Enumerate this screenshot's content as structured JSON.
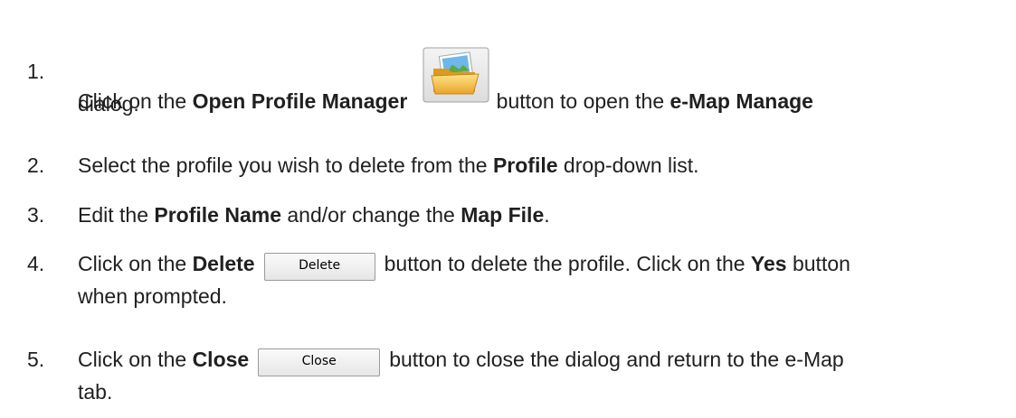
{
  "steps": [
    {
      "number": "1.",
      "parts": [
        "Click on the ",
        "Open Profile Manager",
        "button to open the ",
        "e-Map Manage"
      ],
      "line2": "dialog.",
      "icon": "folder-picture-icon"
    },
    {
      "number": "2.",
      "parts": [
        "Select the profile you wish to delete from the ",
        "Profile",
        " drop-down list."
      ]
    },
    {
      "number": "3.",
      "parts": [
        "Edit the ",
        "Profile Name",
        " and/or change the ",
        "Map File",
        "."
      ]
    },
    {
      "number": "4.",
      "parts": [
        "Click on the ",
        "Delete",
        "button to delete the profile. Click on the ",
        "Yes",
        " button"
      ],
      "button_label": "Delete",
      "line2": "when prompted."
    },
    {
      "number": "5.",
      "parts": [
        "Click on the ",
        "Close",
        "button to close the dialog and return to the e-Map"
      ],
      "button_label": "Close",
      "line2": "tab."
    }
  ]
}
